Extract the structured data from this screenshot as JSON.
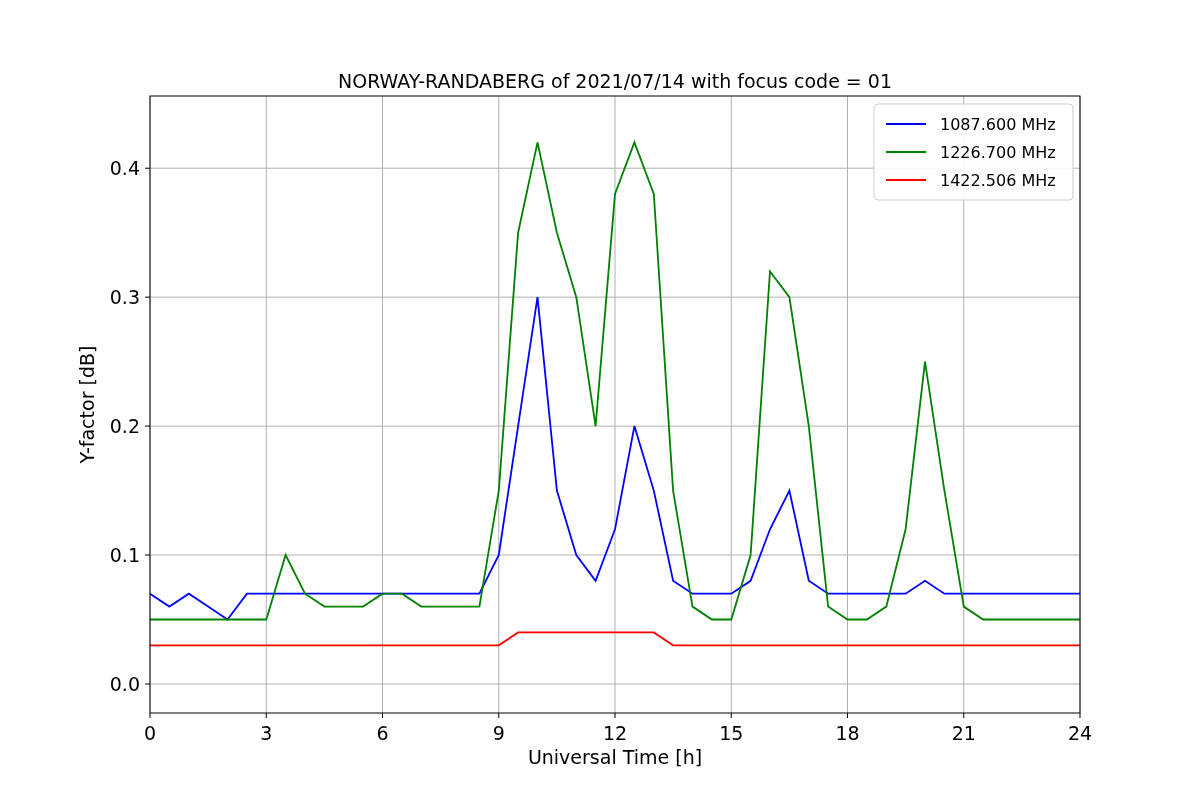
{
  "chart_data": {
    "type": "line",
    "title": "NORWAY-RANDABERG of 2021/07/14 with focus code = 01",
    "xlabel": "Universal Time [h]",
    "ylabel": "Y-factor [dB]",
    "x": [
      0,
      0.5,
      1,
      1.5,
      2,
      2.5,
      3,
      3.5,
      4,
      4.5,
      5,
      5.5,
      6,
      6.5,
      7,
      7.5,
      8,
      8.5,
      9,
      9.5,
      10,
      10.5,
      11,
      11.5,
      12,
      12.5,
      13,
      13.5,
      14,
      14.5,
      15,
      15.5,
      16,
      16.5,
      17,
      17.5,
      18,
      18.5,
      19,
      19.5,
      20,
      20.5,
      21,
      21.5,
      22,
      22.5,
      23,
      23.5,
      24
    ],
    "series": [
      {
        "name": "1087.600 MHz",
        "color": "#0000ff",
        "values": [
          0.07,
          0.06,
          0.07,
          0.06,
          0.05,
          0.07,
          0.07,
          0.07,
          0.07,
          0.07,
          0.07,
          0.07,
          0.07,
          0.07,
          0.07,
          0.07,
          0.07,
          0.07,
          0.1,
          0.2,
          0.3,
          0.15,
          0.1,
          0.08,
          0.12,
          0.2,
          0.15,
          0.08,
          0.07,
          0.07,
          0.07,
          0.08,
          0.12,
          0.15,
          0.08,
          0.07,
          0.07,
          0.07,
          0.07,
          0.07,
          0.08,
          0.07,
          0.07,
          0.07,
          0.07,
          0.07,
          0.07,
          0.07,
          0.07
        ]
      },
      {
        "name": "1226.700 MHz",
        "color": "#008000",
        "values": [
          0.05,
          0.05,
          0.05,
          0.05,
          0.05,
          0.05,
          0.05,
          0.1,
          0.07,
          0.06,
          0.06,
          0.06,
          0.07,
          0.07,
          0.06,
          0.06,
          0.06,
          0.06,
          0.15,
          0.35,
          0.42,
          0.35,
          0.3,
          0.2,
          0.38,
          0.42,
          0.38,
          0.15,
          0.06,
          0.05,
          0.05,
          0.1,
          0.32,
          0.3,
          0.2,
          0.06,
          0.05,
          0.05,
          0.06,
          0.12,
          0.25,
          0.15,
          0.06,
          0.05,
          0.05,
          0.05,
          0.05,
          0.05,
          0.05
        ]
      },
      {
        "name": "1422.506 MHz",
        "color": "#ff0000",
        "values": [
          0.03,
          0.03,
          0.03,
          0.03,
          0.03,
          0.03,
          0.03,
          0.03,
          0.03,
          0.03,
          0.03,
          0.03,
          0.03,
          0.03,
          0.03,
          0.03,
          0.03,
          0.03,
          0.03,
          0.04,
          0.04,
          0.04,
          0.04,
          0.04,
          0.04,
          0.04,
          0.04,
          0.03,
          0.03,
          0.03,
          0.03,
          0.03,
          0.03,
          0.03,
          0.03,
          0.03,
          0.03,
          0.03,
          0.03,
          0.03,
          0.03,
          0.03,
          0.03,
          0.03,
          0.03,
          0.03,
          0.03,
          0.03,
          0.03
        ]
      }
    ],
    "grid": true,
    "legend": true,
    "xlim": [
      0,
      24
    ],
    "ylim": [
      -0.0225,
      0.456
    ],
    "xticks": [
      0,
      3,
      6,
      9,
      12,
      15,
      18,
      21,
      24
    ],
    "yticks": [
      {
        "value": 0,
        "label": "0.0"
      },
      {
        "value": 0.1,
        "label": "0.1"
      },
      {
        "value": 0.2,
        "label": "0.2"
      },
      {
        "value": 0.3,
        "label": "0.3"
      },
      {
        "value": 0.4,
        "label": "0.4"
      }
    ]
  }
}
